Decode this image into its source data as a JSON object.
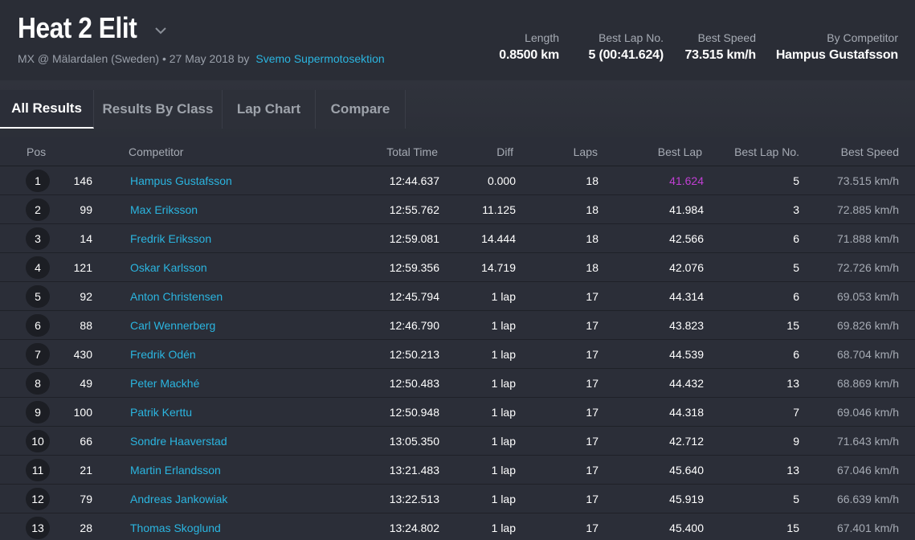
{
  "header": {
    "title": "Heat 2 Elit",
    "event": "MX @ Mälardalen (Sweden) • 27 May 2018 by",
    "organizer": "Svemo Supermotosektion",
    "stats": [
      {
        "label": "Length",
        "value": "0.8500 km"
      },
      {
        "label": "Best Lap No.",
        "value": "5 (00:41.624)"
      },
      {
        "label": "Best Speed",
        "value": "73.515 km/h"
      },
      {
        "label": "By Competitor",
        "value": "Hampus Gustafsson"
      }
    ]
  },
  "tabs": [
    "All Results",
    "Results By Class",
    "Lap Chart",
    "Compare"
  ],
  "columns": [
    "Pos",
    "Competitor",
    "Total Time",
    "Diff",
    "Laps",
    "Best Lap",
    "Best Lap No.",
    "Best Speed"
  ],
  "rows": [
    {
      "pos": "1",
      "num": "146",
      "name": "Hampus Gustafsson",
      "total": "12:44.637",
      "diff": "0.000",
      "laps": "18",
      "best": "41.624",
      "bestno": "5",
      "speed": "73.515 km/h"
    },
    {
      "pos": "2",
      "num": "99",
      "name": "Max Eriksson",
      "total": "12:55.762",
      "diff": "11.125",
      "laps": "18",
      "best": "41.984",
      "bestno": "3",
      "speed": "72.885 km/h"
    },
    {
      "pos": "3",
      "num": "14",
      "name": "Fredrik Eriksson",
      "total": "12:59.081",
      "diff": "14.444",
      "laps": "18",
      "best": "42.566",
      "bestno": "6",
      "speed": "71.888 km/h"
    },
    {
      "pos": "4",
      "num": "121",
      "name": "Oskar Karlsson",
      "total": "12:59.356",
      "diff": "14.719",
      "laps": "18",
      "best": "42.076",
      "bestno": "5",
      "speed": "72.726 km/h"
    },
    {
      "pos": "5",
      "num": "92",
      "name": "Anton Christensen",
      "total": "12:45.794",
      "diff": "1 lap",
      "laps": "17",
      "best": "44.314",
      "bestno": "6",
      "speed": "69.053 km/h"
    },
    {
      "pos": "6",
      "num": "88",
      "name": "Carl Wennerberg",
      "total": "12:46.790",
      "diff": "1 lap",
      "laps": "17",
      "best": "43.823",
      "bestno": "15",
      "speed": "69.826 km/h"
    },
    {
      "pos": "7",
      "num": "430",
      "name": "Fredrik Odén",
      "total": "12:50.213",
      "diff": "1 lap",
      "laps": "17",
      "best": "44.539",
      "bestno": "6",
      "speed": "68.704 km/h"
    },
    {
      "pos": "8",
      "num": "49",
      "name": "Peter Mackhé",
      "total": "12:50.483",
      "diff": "1 lap",
      "laps": "17",
      "best": "44.432",
      "bestno": "13",
      "speed": "68.869 km/h"
    },
    {
      "pos": "9",
      "num": "100",
      "name": "Patrik Kerttu",
      "total": "12:50.948",
      "diff": "1 lap",
      "laps": "17",
      "best": "44.318",
      "bestno": "7",
      "speed": "69.046 km/h"
    },
    {
      "pos": "10",
      "num": "66",
      "name": "Sondre Haaverstad",
      "total": "13:05.350",
      "diff": "1 lap",
      "laps": "17",
      "best": "42.712",
      "bestno": "9",
      "speed": "71.643 km/h"
    },
    {
      "pos": "11",
      "num": "21",
      "name": "Martin Erlandsson",
      "total": "13:21.483",
      "diff": "1 lap",
      "laps": "17",
      "best": "45.640",
      "bestno": "13",
      "speed": "67.046 km/h"
    },
    {
      "pos": "12",
      "num": "79",
      "name": "Andreas Jankowiak",
      "total": "13:22.513",
      "diff": "1 lap",
      "laps": "17",
      "best": "45.919",
      "bestno": "5",
      "speed": "66.639 km/h"
    },
    {
      "pos": "13",
      "num": "28",
      "name": "Thomas Skoglund",
      "total": "13:24.802",
      "diff": "1 lap",
      "laps": "17",
      "best": "45.400",
      "bestno": "15",
      "speed": "67.401 km/h"
    }
  ],
  "colors": {
    "accent": "#2bb5e0",
    "best_lap_highlight": "#c13fd4",
    "background": "#2b2e38"
  }
}
